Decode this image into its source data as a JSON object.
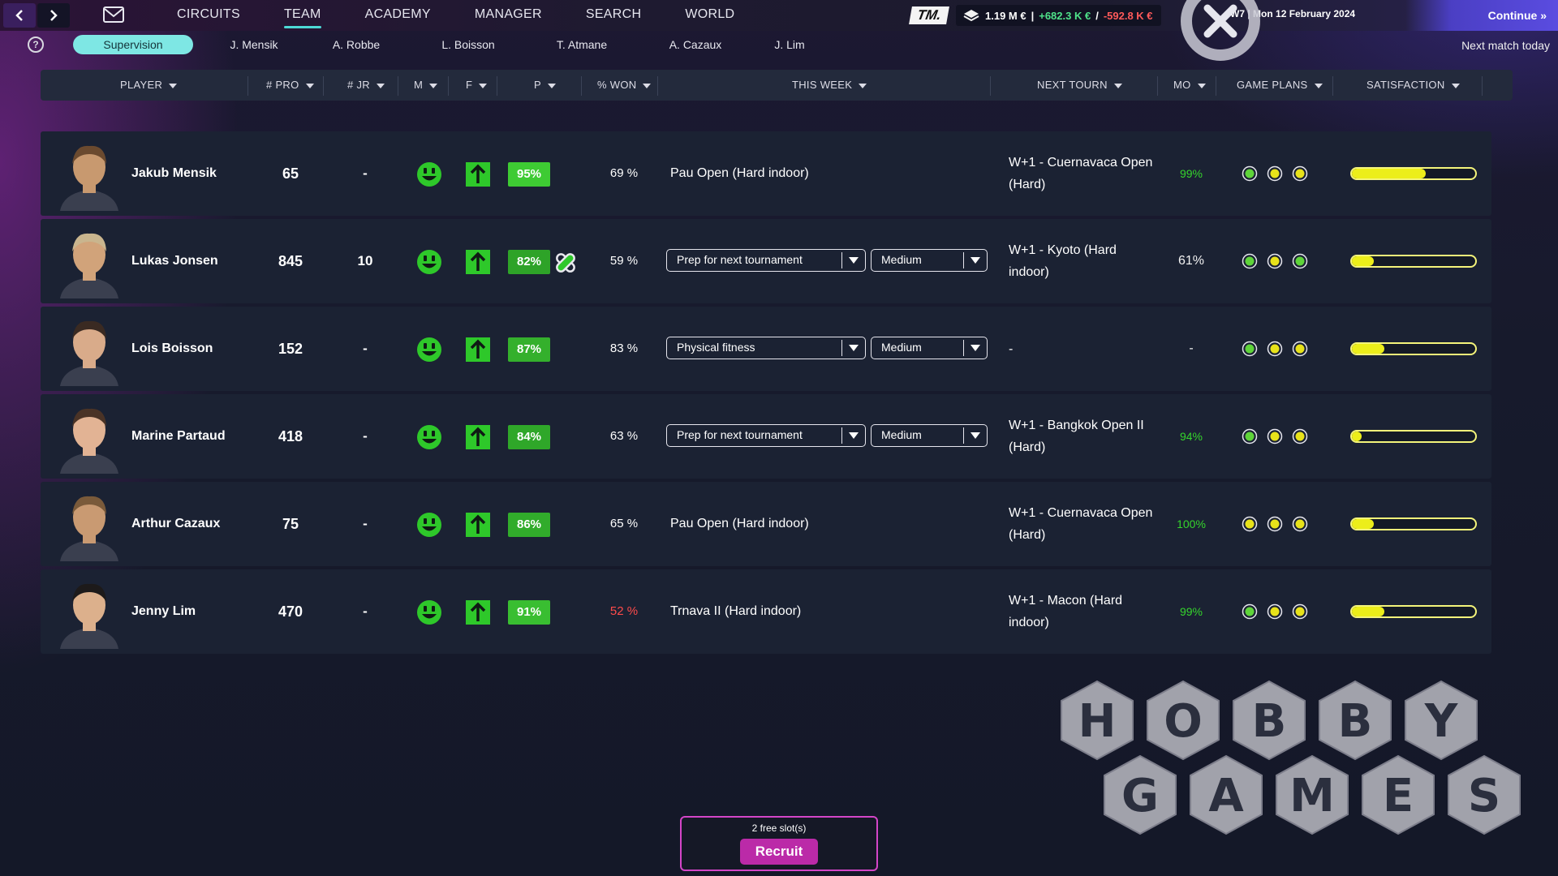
{
  "topbar": {
    "nav": [
      "CIRCUITS",
      "TEAM",
      "ACADEMY",
      "MANAGER",
      "SEARCH",
      "WORLD"
    ],
    "active_nav": "TEAM",
    "logo_text": "TM.",
    "finance": {
      "balance": "1.19 M €",
      "separator": "|",
      "income": "+682.3 K €",
      "slash": "/",
      "expense": "-592.8 K €"
    },
    "date": "W7 | Mon 12 February 2024",
    "continue_label": "Continue »"
  },
  "subnav": {
    "tabs": [
      "Supervision",
      "J. Mensik",
      "A. Robbe",
      "L. Boisson",
      "T. Atmane",
      "A. Cazaux",
      "J. Lim"
    ],
    "next_match": "Next match today"
  },
  "table": {
    "headers": [
      "PLAYER",
      "# PRO",
      "# JR",
      "M",
      "F",
      "P",
      "% WON",
      "THIS WEEK",
      "NEXT TOURN",
      "MO",
      "GAME PLANS",
      "SATISFACTION"
    ],
    "rows": [
      {
        "name": "Jakub Mensik",
        "pro": "65",
        "jr": "-",
        "p": "95%",
        "won": "69 %",
        "won_low": false,
        "week_text": "Pau Open (Hard indoor)",
        "week_select": null,
        "week_intensity": null,
        "next_tourn": "W+1 - Cuernavaca Open (Hard)",
        "mo": "99%",
        "mo_color": "green",
        "game_plans": [
          "green",
          "yellow",
          "yellow"
        ],
        "satisfaction": 0.6,
        "injured": false,
        "p_color": "#3ecb33"
      },
      {
        "name": "Lukas Jonsen",
        "pro": "845",
        "jr": "10",
        "p": "82%",
        "won": "59 %",
        "won_low": false,
        "week_text": null,
        "week_select": "Prep for next tournament",
        "week_intensity": "Medium",
        "next_tourn": "W+1 - Kyoto (Hard indoor)",
        "mo": "61%",
        "mo_color": "white",
        "game_plans": [
          "green",
          "yellow",
          "green"
        ],
        "satisfaction": 0.18,
        "injured": true,
        "p_color": "#2ea328"
      },
      {
        "name": "Lois Boisson",
        "pro": "152",
        "jr": "-",
        "p": "87%",
        "won": "83 %",
        "won_low": false,
        "week_text": null,
        "week_select": "Physical fitness",
        "week_intensity": "Medium",
        "next_tourn": "-",
        "mo": "-",
        "mo_color": "white",
        "game_plans": [
          "green",
          "yellow",
          "yellow"
        ],
        "satisfaction": 0.26,
        "injured": false,
        "p_color": "#34b02c"
      },
      {
        "name": "Marine Partaud",
        "pro": "418",
        "jr": "-",
        "p": "84%",
        "won": "63 %",
        "won_low": false,
        "week_text": null,
        "week_select": "Prep for next tournament",
        "week_intensity": "Medium",
        "next_tourn": "W+1 - Bangkok Open II (Hard)",
        "mo": "94%",
        "mo_color": "green",
        "game_plans": [
          "green",
          "yellow",
          "yellow"
        ],
        "satisfaction": 0.08,
        "injured": false,
        "p_color": "#2fa729"
      },
      {
        "name": "Arthur Cazaux",
        "pro": "75",
        "jr": "-",
        "p": "86%",
        "won": "65 %",
        "won_low": false,
        "week_text": "Pau Open (Hard indoor)",
        "week_select": null,
        "week_intensity": null,
        "next_tourn": "W+1 - Cuernavaca Open (Hard)",
        "mo": "100%",
        "mo_color": "green",
        "game_plans": [
          "yellow",
          "yellow",
          "yellow"
        ],
        "satisfaction": 0.18,
        "injured": false,
        "p_color": "#31ac2b"
      },
      {
        "name": "Jenny Lim",
        "pro": "470",
        "jr": "-",
        "p": "91%",
        "won": "52 %",
        "won_low": true,
        "week_text": "Trnava II (Hard indoor)",
        "week_select": null,
        "week_intensity": null,
        "next_tourn": "W+1 - Macon (Hard indoor)",
        "mo": "99%",
        "mo_color": "green",
        "game_plans": [
          "green",
          "yellow",
          "yellow"
        ],
        "satisfaction": 0.26,
        "injured": false,
        "p_color": "#39be31"
      }
    ]
  },
  "recruit": {
    "free_slots": "2 free slot(s)",
    "button": "Recruit"
  },
  "watermark": {
    "line1": "HOBBY",
    "line2": "GAMES"
  },
  "colors": {
    "accent": "#7ee7e4",
    "recruit": "#bb2aa8",
    "positive": "#4fe38a",
    "negative": "#ff5a5a",
    "gp_green": "#5fd43a",
    "gp_yellow": "#e8e21a",
    "satisfaction": "#ecee1a"
  }
}
